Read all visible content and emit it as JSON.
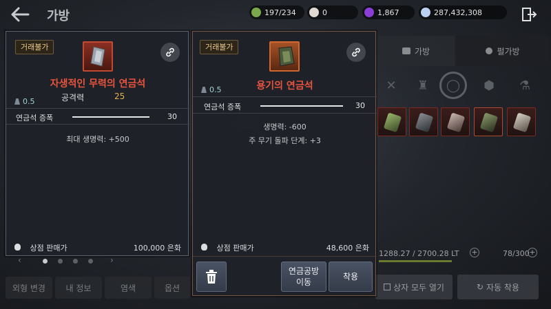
{
  "header": {
    "title": "가방"
  },
  "currencies": [
    {
      "value": "197/234",
      "color": "#7aa84a"
    },
    {
      "value": "0",
      "color": "#e0d8d2"
    },
    {
      "value": "1,867",
      "color": "#8a3ed6"
    },
    {
      "value": "287,432,308",
      "color": "#b9d0ee"
    }
  ],
  "inventory": {
    "tabs": [
      "가방",
      "펄가방"
    ],
    "weight": "1288.27 / 2700.28 LT",
    "slots": "78/300",
    "open_all_label": "상자 모두 열기",
    "auto_equip_label": "자동 착용"
  },
  "bottom_nav": [
    "외형 변경",
    "내 정보",
    "염색",
    "옵션"
  ],
  "items": [
    {
      "tag": "거래불가",
      "name": "자생적인 무력의 연금석",
      "attr_label": "공격력",
      "attr_value": "25",
      "weight": "0.5",
      "amp_label": "연금석 증폭",
      "amp_value": "30",
      "stats": [
        "최대 생명력: +500"
      ],
      "sell_label": "상점 판매가",
      "sell_price": "100,000 은화"
    },
    {
      "tag": "거래불가",
      "name": "용기의 연금석",
      "weight": "0.5",
      "amp_label": "연금석 증폭",
      "amp_value": "30",
      "stats": [
        "생명력: -600",
        "주 무기 돌파 단계: +3"
      ],
      "sell_label": "상점 판매가",
      "sell_price": "48,600 은화"
    }
  ],
  "actions": {
    "alchemy_lab_label_1": "연금공방",
    "alchemy_lab_label_2": "이동",
    "equip_label": "착용"
  }
}
